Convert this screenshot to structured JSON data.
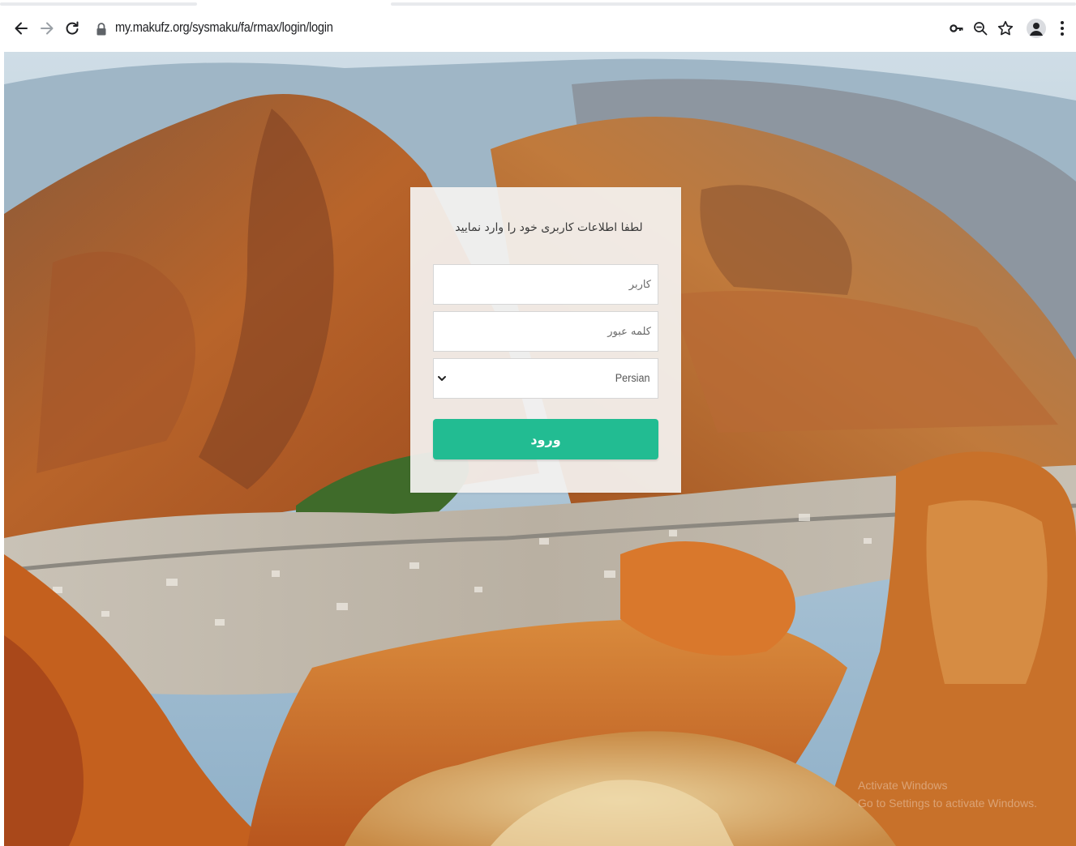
{
  "browser": {
    "url": "my.makufz.org/sysmaku/fa/rmax/login/login",
    "icons": {
      "back": "arrow-left-icon",
      "forward": "arrow-right-icon",
      "reload": "reload-icon",
      "lock": "lock-icon",
      "key": "key-icon",
      "zoom": "zoom-icon",
      "bookmark": "star-icon",
      "profile": "profile-icon",
      "menu": "kebab-menu-icon"
    }
  },
  "login": {
    "title": "لطفا اطلاعات کاربری خود را وارد نمایید",
    "username_placeholder": "کاربر",
    "username_value": "",
    "password_placeholder": "کلمه عبور",
    "password_value": "",
    "language_selected": "Persian",
    "submit_label": "ورود",
    "submit_color": "#22bc92"
  },
  "overlay": {
    "watermark_line1": "Activate Windows",
    "watermark_line2": "Go to Settings to activate Windows."
  }
}
